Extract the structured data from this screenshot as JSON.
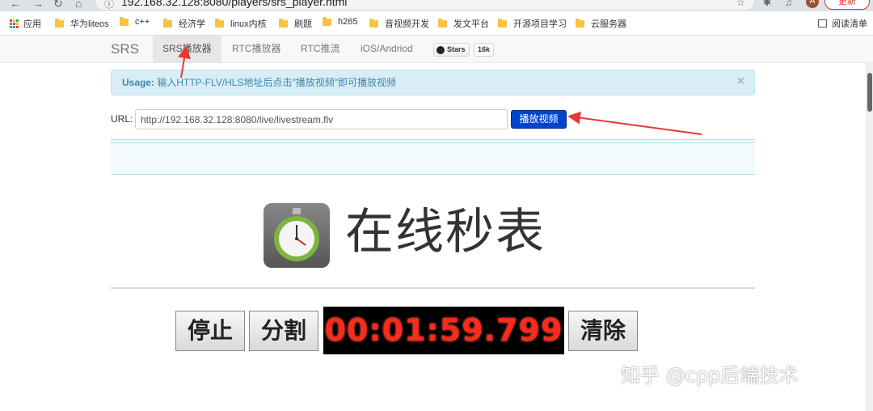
{
  "browser": {
    "url": "192.168.32.128:8080/players/srs_player.html",
    "update_label": "更新",
    "avatar_letter": "A"
  },
  "bookmarks": {
    "apps_label": "应用",
    "items": [
      "华为liteos",
      "c++",
      "经济学",
      "linux内核",
      "刷题",
      "h265",
      "音视频开发",
      "发文平台",
      "开源项目学习",
      "云服务器"
    ],
    "reading_list": "阅读清单"
  },
  "navbar": {
    "brand": "SRS",
    "items": [
      "SRS播放器",
      "RTC播放器",
      "RTC推流",
      "iOS/Andriod"
    ],
    "active_index": 0,
    "github_stars_label": "Stars",
    "github_stars_count": "16k"
  },
  "alert": {
    "title": "Usage:",
    "message": "输入HTTP-FLV/HLS地址后点击\"播放视频\"即可播放视频",
    "close": "×"
  },
  "player": {
    "url_label": "URL:",
    "url_value": "http://192.168.32.128:8080/live/livestream.flv",
    "play_button": "播放视频"
  },
  "stopwatch": {
    "title": "在线秒表",
    "stop_button": "停止",
    "split_button": "分割",
    "time": "00:01:59.799",
    "clear_button": "清除"
  },
  "watermark": "知乎 @cpp后端技术",
  "colors": {
    "alert_bg": "#d9edf7",
    "play_button_bg": "#0044cc",
    "timer_text": "#ff2a1a",
    "annotation_arrow": "#e53935"
  }
}
